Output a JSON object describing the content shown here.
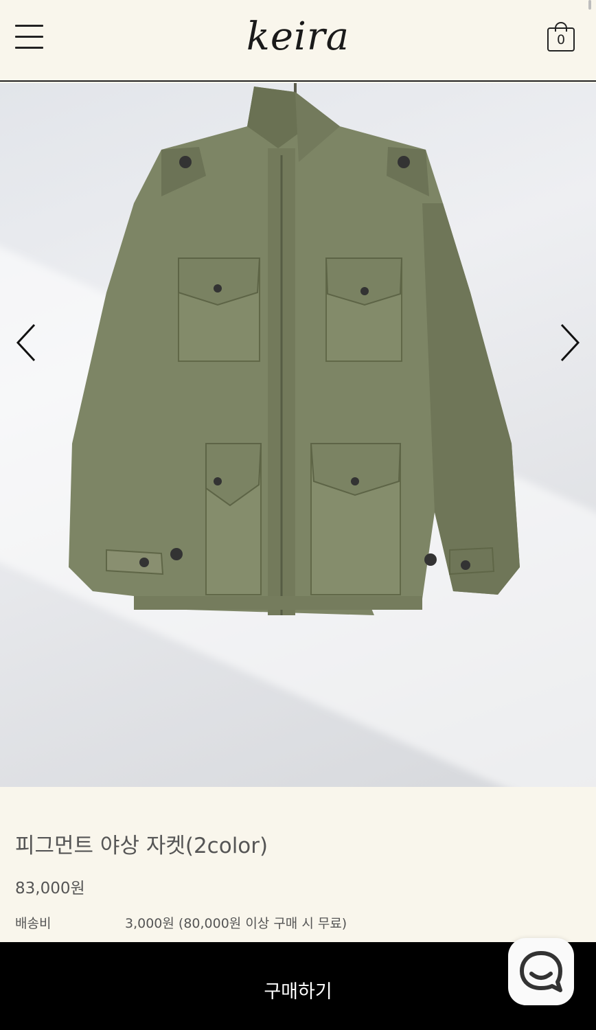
{
  "header": {
    "menu_icon": "hamburger-menu-icon",
    "logo": "keira",
    "cart_icon": "shopping-bag-icon",
    "cart_count": "0"
  },
  "gallery": {
    "image_alt": "jacket-product-photo",
    "prev_icon": "chevron-left-icon",
    "next_icon": "chevron-right-icon"
  },
  "product": {
    "title": "피그먼트 야상 자켓(2color)",
    "price": "83,000원",
    "shipping_label": "배송비",
    "shipping_value": "3,000원 (80,000원 이상 구매 시 무료)"
  },
  "buy_bar": {
    "label": "구매하기"
  },
  "chat": {
    "icon": "chat-bubble-icon"
  },
  "colors": {
    "background": "#f9f6ec",
    "buy_bar": "#000000",
    "jacket": "#7d8565"
  }
}
